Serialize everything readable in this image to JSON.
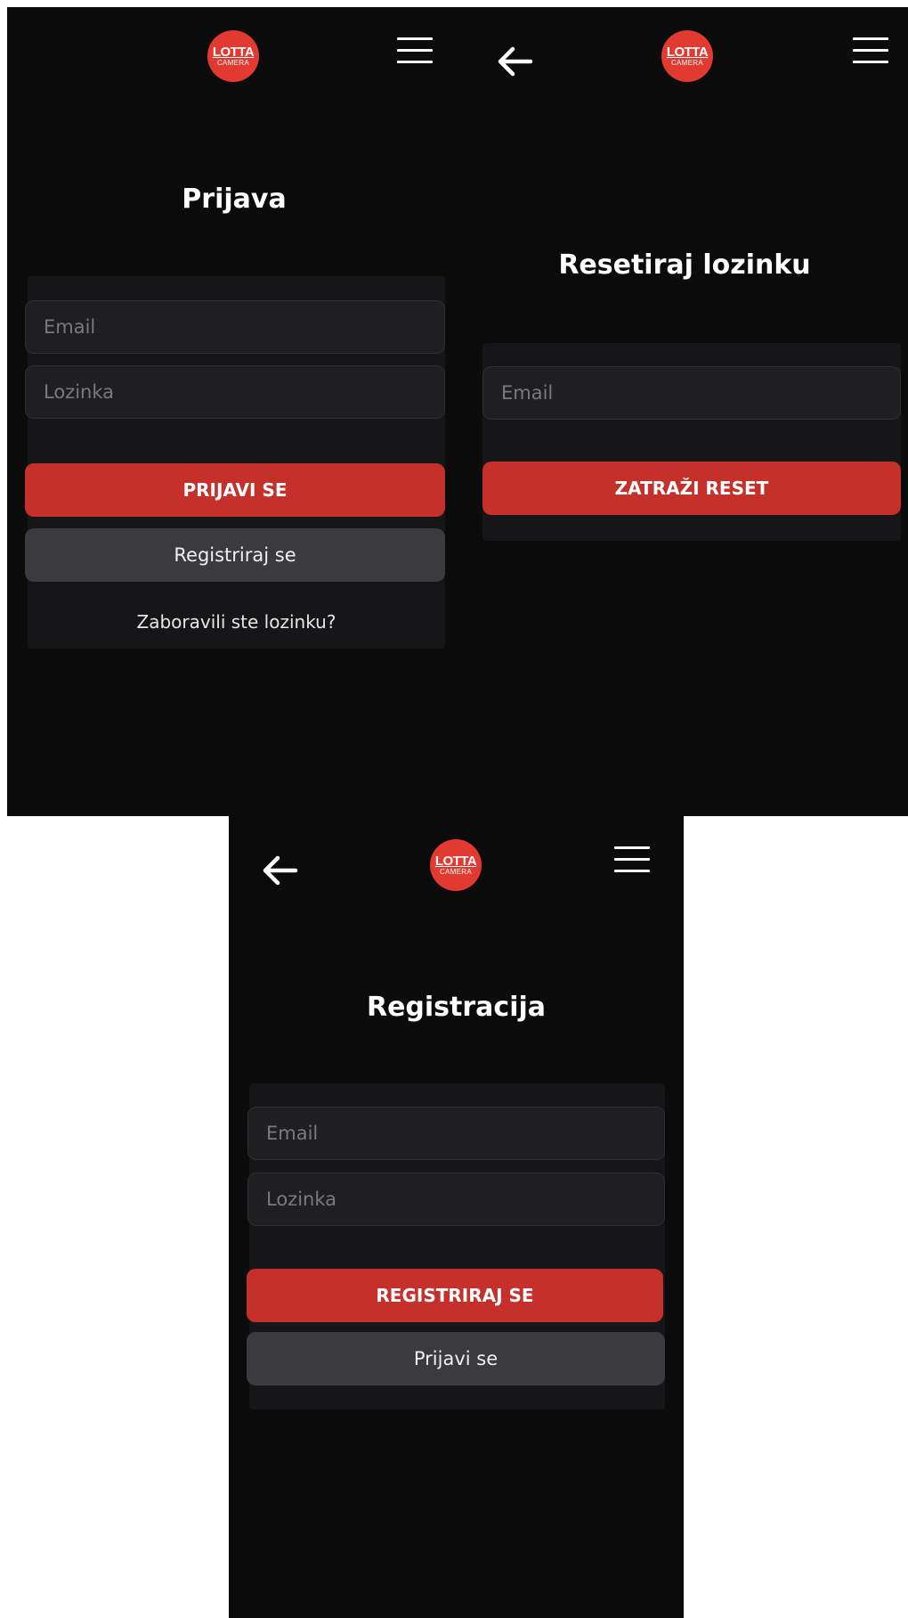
{
  "brand": {
    "logo_line1": "LOTTA",
    "logo_line2": "CAMERA",
    "logo_color": "#e23a30"
  },
  "colors": {
    "background": "#0b0b0c",
    "card": "#161618",
    "input": "#1f1f22",
    "primary_button": "#c5302a",
    "secondary_button": "#3a3a3f"
  },
  "icons": {
    "menu": "hamburger-menu-icon",
    "back": "arrow-left-icon"
  },
  "login": {
    "title": "Prijava",
    "email_placeholder": "Email",
    "password_placeholder": "Lozinka",
    "submit_label": "PRIJAVI SE",
    "register_label": "Registriraj se",
    "forgot_label": "Zaboravili ste lozinku?"
  },
  "reset": {
    "title": "Resetiraj lozinku",
    "email_placeholder": "Email",
    "submit_label": "ZATRAŽI RESET"
  },
  "register": {
    "title": "Registracija",
    "email_placeholder": "Email",
    "password_placeholder": "Lozinka",
    "submit_label": "REGISTRIRAJ SE",
    "login_label": "Prijavi se"
  }
}
